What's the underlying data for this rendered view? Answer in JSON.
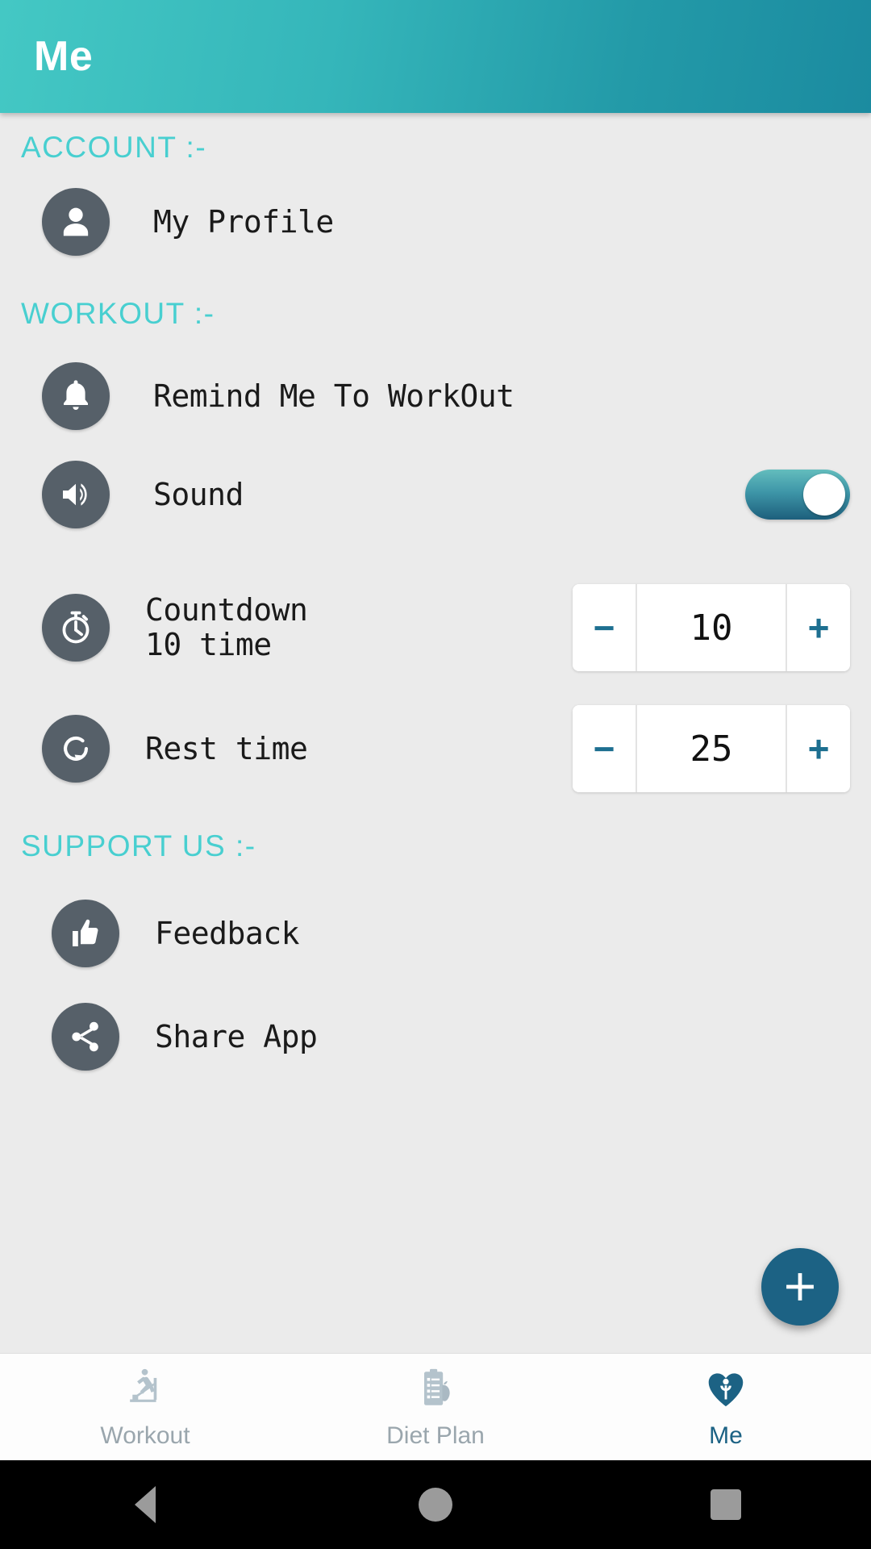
{
  "appbar": {
    "title": "Me"
  },
  "sections": {
    "account": {
      "title": "ACCOUNT  :-"
    },
    "workout": {
      "title": "WORKOUT  :-"
    },
    "support": {
      "title": "SUPPORT US  :-"
    }
  },
  "rows": {
    "profile": {
      "label": "My Profile",
      "icon": "person-icon"
    },
    "remind": {
      "label": "Remind Me To WorkOut",
      "icon": "bell-icon"
    },
    "sound": {
      "label": "Sound",
      "icon": "volume-icon",
      "toggle_on": true
    },
    "countdown": {
      "label": "Countdown\n 10 time",
      "icon": "stopwatch-icon"
    },
    "rest": {
      "label": "Rest time",
      "icon": "restore-icon"
    },
    "feedback": {
      "label": "Feedback",
      "icon": "thumbs-up-icon"
    },
    "share": {
      "label": "Share App",
      "icon": "share-icon"
    }
  },
  "steppers": {
    "countdown": {
      "minus": "−",
      "value": "10",
      "plus": "+"
    },
    "rest": {
      "minus": "−",
      "value": "25",
      "plus": "+"
    }
  },
  "fab": {
    "icon": "plus-icon",
    "label": "+"
  },
  "bottom_nav": {
    "items": [
      {
        "label": "Workout",
        "icon": "treadmill-icon",
        "active": false
      },
      {
        "label": "Diet Plan",
        "icon": "clipboard-apple-icon",
        "active": false
      },
      {
        "label": "Me",
        "icon": "heart-person-icon",
        "active": true
      }
    ]
  },
  "system_nav": {
    "back": "back-icon",
    "home": "home-icon",
    "recents": "recents-icon"
  },
  "colors": {
    "appbar_gradient_start": "#44c8c4",
    "appbar_gradient_end": "#1b8ba0",
    "section_title": "#48cfd0",
    "icon_circle": "#566069",
    "accent_dark": "#1c6284",
    "page_background": "#ebebeb",
    "nav_inactive": "#9aa6ad"
  }
}
